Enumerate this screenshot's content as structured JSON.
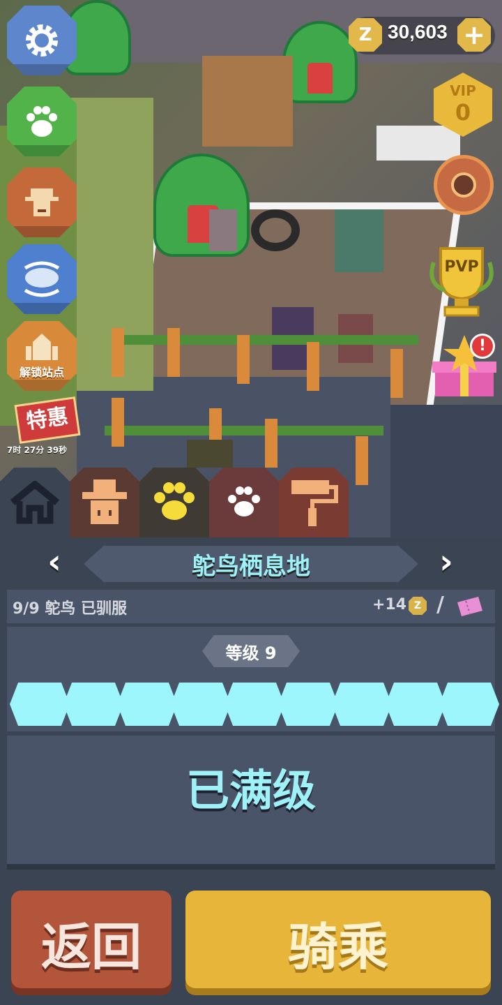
{
  "hud": {
    "currency_symbol": "Z",
    "coins": "30,603",
    "add_label": "+",
    "vip_label": "VIP",
    "vip_level": "0",
    "pvp_label": "PVP",
    "gift_alert": "!"
  },
  "left_menu": {
    "unlock_label": "解锁站点",
    "sale_label": "特惠",
    "sale_timer": "7时 27分 39秒"
  },
  "tabs": [
    {
      "name": "home",
      "color": "#3b4453"
    },
    {
      "name": "keeper",
      "color": "#5a3a33"
    },
    {
      "name": "animals",
      "color": "#3f3a33"
    },
    {
      "name": "paw",
      "color": "#6b3a3a"
    },
    {
      "name": "decorate",
      "color": "#7a3b33"
    }
  ],
  "habitat": {
    "title": "鸵鸟栖息地",
    "tamed_text": "9/9 鸵鸟 已驯服",
    "bonus": "+14",
    "separator": "/",
    "level_label": "等级 9",
    "level_current": 9,
    "level_max": 9,
    "max_text": "已满级"
  },
  "buttons": {
    "back": "返回",
    "ride": "骑乘"
  },
  "colors": {
    "accent_cyan": "#9ef1f7",
    "gold": "#e2b84a",
    "back_button": "#b3553a",
    "ride_button": "#e6b53a"
  }
}
